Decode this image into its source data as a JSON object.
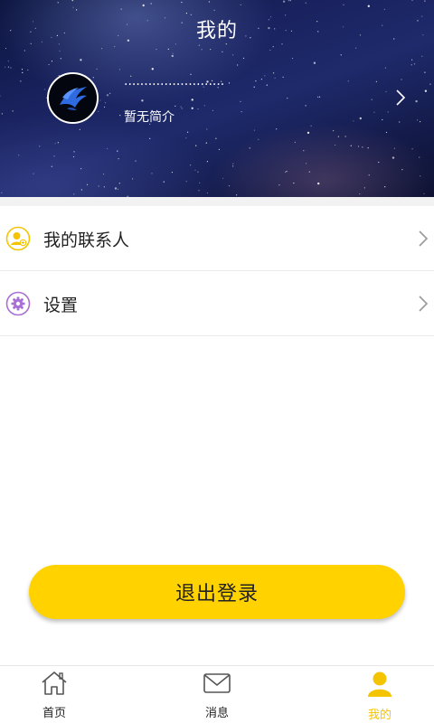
{
  "header": {
    "title": "我的",
    "nickname": "·························",
    "bio": "暂无简介"
  },
  "menu": [
    {
      "label": "我的联系人",
      "icon": "contact-icon",
      "color": "#f5c400"
    },
    {
      "label": "设置",
      "icon": "settings-gear-icon",
      "color": "#a86fd6"
    }
  ],
  "logout": {
    "label": "退出登录",
    "color": "#ffd200"
  },
  "tabbar": {
    "items": [
      {
        "label": "首页",
        "icon": "home-icon",
        "active": false
      },
      {
        "label": "消息",
        "icon": "mail-icon",
        "active": false
      },
      {
        "label": "我的",
        "icon": "user-icon",
        "active": true
      }
    ],
    "active_color": "#f5c400"
  }
}
